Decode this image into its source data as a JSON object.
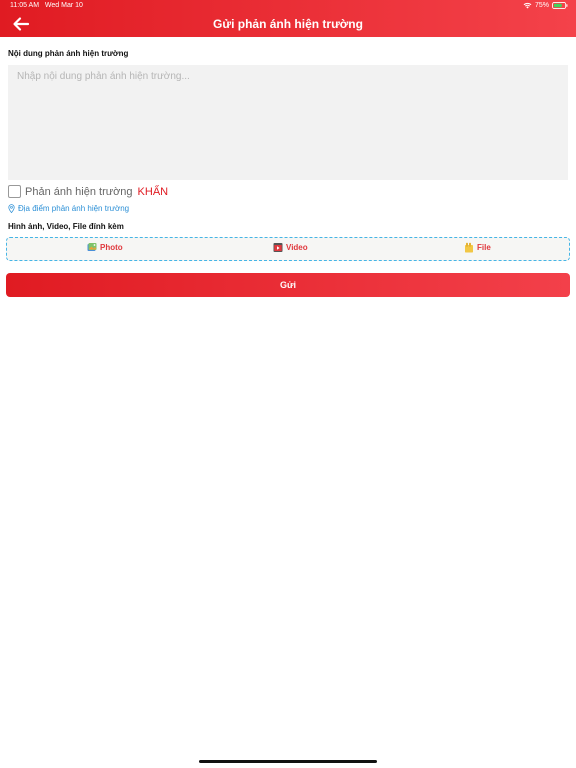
{
  "status_bar": {
    "time": "11:05 AM",
    "date": "Wed Mar 10",
    "battery": "75%"
  },
  "header": {
    "title": "Gửi phản ánh hiện trường",
    "back_icon": "arrow-left-icon"
  },
  "content_section": {
    "label": "Nội dung phản ánh hiện trường",
    "placeholder": "Nhập nội dung phản ánh hiện trường..."
  },
  "urgent": {
    "label": "Phản ánh hiện trường",
    "keyword": "KHẨN",
    "checked": false
  },
  "location": {
    "label": "Địa điểm phản ánh hiện trường"
  },
  "attachments": {
    "label": "Hình ảnh, Video, File đính kèm",
    "photo_label": "Photo",
    "video_label": "Video",
    "file_label": "File"
  },
  "send_button": {
    "label": "Gửi"
  },
  "colors": {
    "accent": "#e01b22",
    "link": "#2b8fd6",
    "dashed_border": "#45b5e6"
  }
}
